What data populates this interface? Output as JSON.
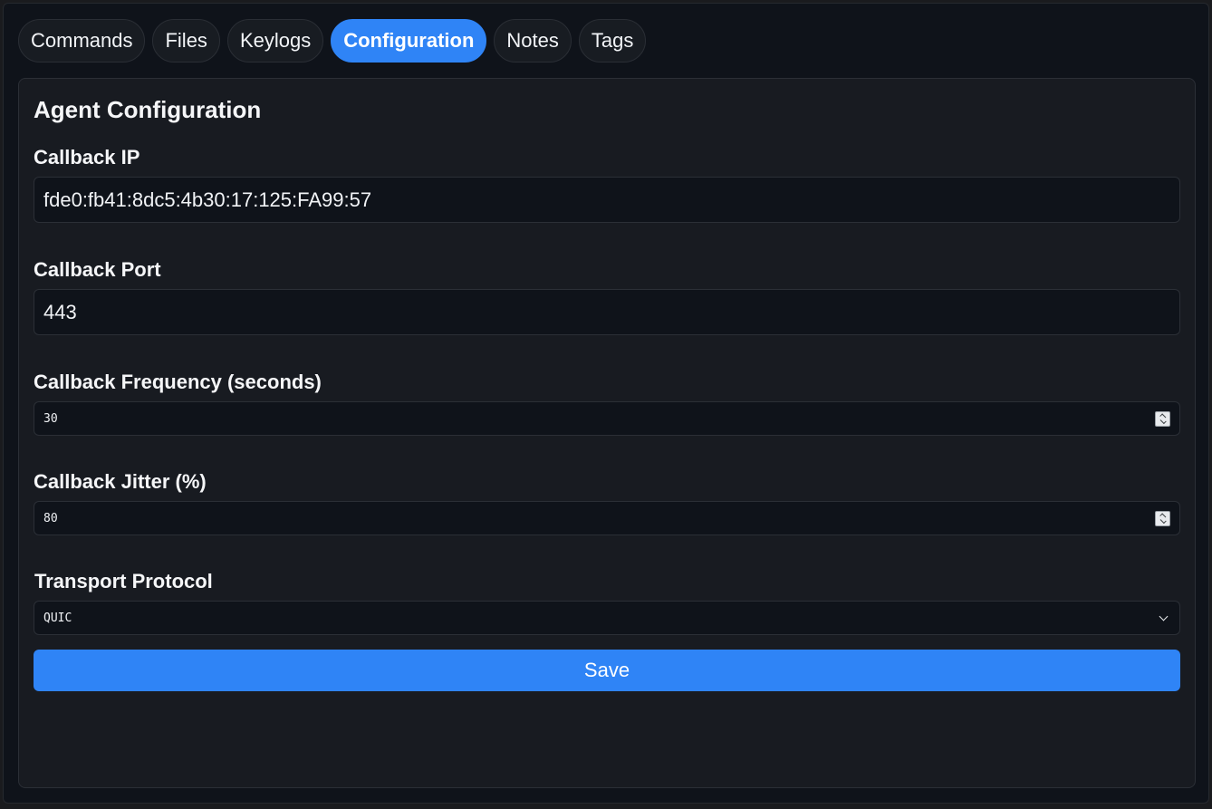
{
  "tabs": [
    {
      "label": "Commands",
      "active": false
    },
    {
      "label": "Files",
      "active": false
    },
    {
      "label": "Keylogs",
      "active": false
    },
    {
      "label": "Configuration",
      "active": true
    },
    {
      "label": "Notes",
      "active": false
    },
    {
      "label": "Tags",
      "active": false
    }
  ],
  "panel": {
    "title": "Agent Configuration",
    "callback_ip": {
      "label": "Callback IP",
      "value": "fde0:fb41:8dc5:4b30:17:125:FA99:57"
    },
    "callback_port": {
      "label": "Callback Port",
      "value": "443"
    },
    "callback_frequency": {
      "label": "Callback Frequency (seconds)",
      "value": "30"
    },
    "callback_jitter": {
      "label": "Callback Jitter (%)",
      "value": "80"
    },
    "transport_protocol": {
      "label": "Transport Protocol",
      "value": "QUIC"
    },
    "save_label": "Save"
  },
  "colors": {
    "accent": "#2f84f6",
    "background": "#0f131a",
    "panel": "#181b21"
  }
}
